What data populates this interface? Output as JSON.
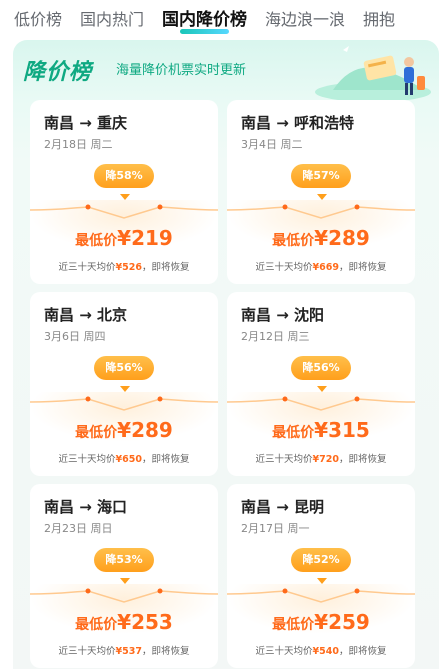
{
  "tabs": [
    {
      "label": "低价榜",
      "active": false
    },
    {
      "label": "国内热门",
      "active": false
    },
    {
      "label": "国内降价榜",
      "active": true
    },
    {
      "label": "海边浪一浪",
      "active": false
    },
    {
      "label": "拥抱",
      "active": false
    }
  ],
  "banner": {
    "title": "降价榜",
    "subtitle": "海量降价机票实时更新"
  },
  "colors": {
    "accent": "#0fa982",
    "price": "#ff6a1a",
    "badge": "#ff9f1c"
  },
  "cards": [
    {
      "route": "南昌 → 重庆",
      "date": "2月18日 周二",
      "discount": "降58%",
      "lowest_label": "最低价",
      "price": "¥219",
      "avg_prefix": "近三十天均价",
      "avg_value": "¥526",
      "avg_suffix": "，即将恢复"
    },
    {
      "route": "南昌 → 呼和浩特",
      "date": "3月4日 周二",
      "discount": "降57%",
      "lowest_label": "最低价",
      "price": "¥289",
      "avg_prefix": "近三十天均价",
      "avg_value": "¥669",
      "avg_suffix": "，即将恢复"
    },
    {
      "route": "南昌 → 北京",
      "date": "3月6日 周四",
      "discount": "降56%",
      "lowest_label": "最低价",
      "price": "¥289",
      "avg_prefix": "近三十天均价",
      "avg_value": "¥650",
      "avg_suffix": "，即将恢复"
    },
    {
      "route": "南昌 → 沈阳",
      "date": "2月12日 周三",
      "discount": "降56%",
      "lowest_label": "最低价",
      "price": "¥315",
      "avg_prefix": "近三十天均价",
      "avg_value": "¥720",
      "avg_suffix": "，即将恢复"
    },
    {
      "route": "南昌 → 海口",
      "date": "2月23日 周日",
      "discount": "降53%",
      "lowest_label": "最低价",
      "price": "¥253",
      "avg_prefix": "近三十天均价",
      "avg_value": "¥537",
      "avg_suffix": "，即将恢复"
    },
    {
      "route": "南昌 → 昆明",
      "date": "2月17日 周一",
      "discount": "降52%",
      "lowest_label": "最低价",
      "price": "¥259",
      "avg_prefix": "近三十天均价",
      "avg_value": "¥540",
      "avg_suffix": "，即将恢复"
    }
  ]
}
